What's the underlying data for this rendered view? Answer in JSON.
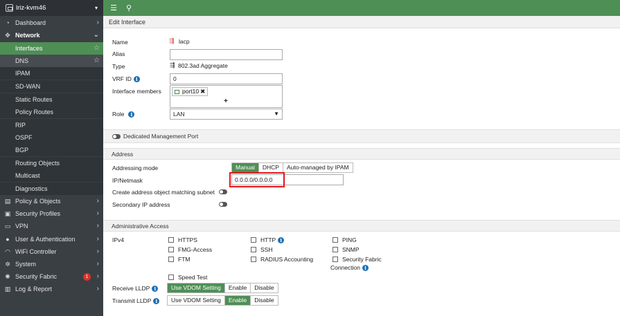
{
  "sidebar": {
    "device_name": "lriz-kvm46",
    "items": [
      {
        "label": "Dashboard"
      },
      {
        "label": "Network"
      },
      {
        "label": "Interfaces"
      },
      {
        "label": "DNS"
      },
      {
        "label": "IPAM"
      },
      {
        "label": "SD-WAN"
      },
      {
        "label": "Static Routes"
      },
      {
        "label": "Policy Routes"
      },
      {
        "label": "RIP"
      },
      {
        "label": "OSPF"
      },
      {
        "label": "BGP"
      },
      {
        "label": "Routing Objects"
      },
      {
        "label": "Multicast"
      },
      {
        "label": "Diagnostics"
      },
      {
        "label": "Policy & Objects"
      },
      {
        "label": "Security Profiles"
      },
      {
        "label": "VPN"
      },
      {
        "label": "User & Authentication"
      },
      {
        "label": "WiFi Controller"
      },
      {
        "label": "System"
      },
      {
        "label": "Security Fabric",
        "badge": "1"
      },
      {
        "label": "Log & Report"
      }
    ]
  },
  "page": {
    "title": "Edit Interface"
  },
  "form": {
    "name_label": "Name",
    "name_value": "lacp",
    "alias_label": "Alias",
    "alias_value": "",
    "type_label": "Type",
    "type_value": "802.3ad Aggregate",
    "vrf_label": "VRF ID",
    "vrf_value": "0",
    "members_label": "Interface members",
    "member_chip": "port10",
    "add_symbol": "+",
    "role_label": "Role",
    "role_value": "LAN",
    "dedicated_mgmt": "Dedicated Management Port"
  },
  "address": {
    "section_title": "Address",
    "mode_label": "Addressing mode",
    "modes": [
      "Manual",
      "DHCP",
      "Auto-managed by IPAM"
    ],
    "ip_label": "IP/Netmask",
    "ip_value": "0.0.0.0/0.0.0.0",
    "create_obj_label": "Create address object matching subnet",
    "secondary_label": "Secondary IP address"
  },
  "admin": {
    "section_title": "Administrative Access",
    "ipv4_label": "IPv4",
    "col1": [
      "HTTPS",
      "FMG-Access",
      "FTM"
    ],
    "col2": [
      "HTTP",
      "SSH",
      "RADIUS Accounting"
    ],
    "col3": [
      "PING",
      "SNMP",
      "Security Fabric"
    ],
    "col3_extra": "Connection",
    "speed_test": "Speed Test",
    "receive_lldp_label": "Receive LLDP",
    "transmit_lldp_label": "Transmit LLDP",
    "lldp_options": [
      "Use VDOM Setting",
      "Enable",
      "Disable"
    ]
  },
  "colors": {
    "accent": "#4e8f55",
    "sidebar_bg": "#3a3f44",
    "highlight": "#e4161c",
    "info": "#1f6fb3"
  }
}
